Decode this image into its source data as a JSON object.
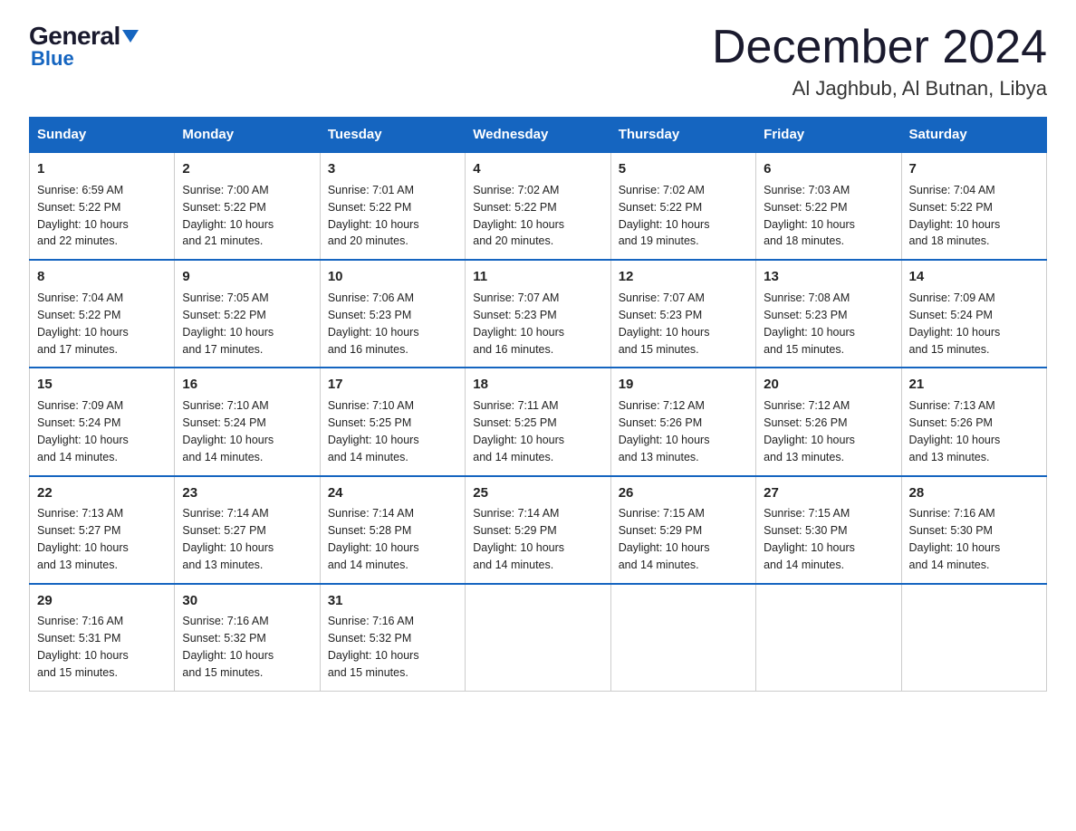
{
  "logo": {
    "general": "General",
    "triangle": "▶",
    "blue": "Blue"
  },
  "header": {
    "month": "December 2024",
    "location": "Al Jaghbub, Al Butnan, Libya"
  },
  "days_of_week": [
    "Sunday",
    "Monday",
    "Tuesday",
    "Wednesday",
    "Thursday",
    "Friday",
    "Saturday"
  ],
  "weeks": [
    [
      {
        "day": "1",
        "info": "Sunrise: 6:59 AM\nSunset: 5:22 PM\nDaylight: 10 hours\nand 22 minutes."
      },
      {
        "day": "2",
        "info": "Sunrise: 7:00 AM\nSunset: 5:22 PM\nDaylight: 10 hours\nand 21 minutes."
      },
      {
        "day": "3",
        "info": "Sunrise: 7:01 AM\nSunset: 5:22 PM\nDaylight: 10 hours\nand 20 minutes."
      },
      {
        "day": "4",
        "info": "Sunrise: 7:02 AM\nSunset: 5:22 PM\nDaylight: 10 hours\nand 20 minutes."
      },
      {
        "day": "5",
        "info": "Sunrise: 7:02 AM\nSunset: 5:22 PM\nDaylight: 10 hours\nand 19 minutes."
      },
      {
        "day": "6",
        "info": "Sunrise: 7:03 AM\nSunset: 5:22 PM\nDaylight: 10 hours\nand 18 minutes."
      },
      {
        "day": "7",
        "info": "Sunrise: 7:04 AM\nSunset: 5:22 PM\nDaylight: 10 hours\nand 18 minutes."
      }
    ],
    [
      {
        "day": "8",
        "info": "Sunrise: 7:04 AM\nSunset: 5:22 PM\nDaylight: 10 hours\nand 17 minutes."
      },
      {
        "day": "9",
        "info": "Sunrise: 7:05 AM\nSunset: 5:22 PM\nDaylight: 10 hours\nand 17 minutes."
      },
      {
        "day": "10",
        "info": "Sunrise: 7:06 AM\nSunset: 5:23 PM\nDaylight: 10 hours\nand 16 minutes."
      },
      {
        "day": "11",
        "info": "Sunrise: 7:07 AM\nSunset: 5:23 PM\nDaylight: 10 hours\nand 16 minutes."
      },
      {
        "day": "12",
        "info": "Sunrise: 7:07 AM\nSunset: 5:23 PM\nDaylight: 10 hours\nand 15 minutes."
      },
      {
        "day": "13",
        "info": "Sunrise: 7:08 AM\nSunset: 5:23 PM\nDaylight: 10 hours\nand 15 minutes."
      },
      {
        "day": "14",
        "info": "Sunrise: 7:09 AM\nSunset: 5:24 PM\nDaylight: 10 hours\nand 15 minutes."
      }
    ],
    [
      {
        "day": "15",
        "info": "Sunrise: 7:09 AM\nSunset: 5:24 PM\nDaylight: 10 hours\nand 14 minutes."
      },
      {
        "day": "16",
        "info": "Sunrise: 7:10 AM\nSunset: 5:24 PM\nDaylight: 10 hours\nand 14 minutes."
      },
      {
        "day": "17",
        "info": "Sunrise: 7:10 AM\nSunset: 5:25 PM\nDaylight: 10 hours\nand 14 minutes."
      },
      {
        "day": "18",
        "info": "Sunrise: 7:11 AM\nSunset: 5:25 PM\nDaylight: 10 hours\nand 14 minutes."
      },
      {
        "day": "19",
        "info": "Sunrise: 7:12 AM\nSunset: 5:26 PM\nDaylight: 10 hours\nand 13 minutes."
      },
      {
        "day": "20",
        "info": "Sunrise: 7:12 AM\nSunset: 5:26 PM\nDaylight: 10 hours\nand 13 minutes."
      },
      {
        "day": "21",
        "info": "Sunrise: 7:13 AM\nSunset: 5:26 PM\nDaylight: 10 hours\nand 13 minutes."
      }
    ],
    [
      {
        "day": "22",
        "info": "Sunrise: 7:13 AM\nSunset: 5:27 PM\nDaylight: 10 hours\nand 13 minutes."
      },
      {
        "day": "23",
        "info": "Sunrise: 7:14 AM\nSunset: 5:27 PM\nDaylight: 10 hours\nand 13 minutes."
      },
      {
        "day": "24",
        "info": "Sunrise: 7:14 AM\nSunset: 5:28 PM\nDaylight: 10 hours\nand 14 minutes."
      },
      {
        "day": "25",
        "info": "Sunrise: 7:14 AM\nSunset: 5:29 PM\nDaylight: 10 hours\nand 14 minutes."
      },
      {
        "day": "26",
        "info": "Sunrise: 7:15 AM\nSunset: 5:29 PM\nDaylight: 10 hours\nand 14 minutes."
      },
      {
        "day": "27",
        "info": "Sunrise: 7:15 AM\nSunset: 5:30 PM\nDaylight: 10 hours\nand 14 minutes."
      },
      {
        "day": "28",
        "info": "Sunrise: 7:16 AM\nSunset: 5:30 PM\nDaylight: 10 hours\nand 14 minutes."
      }
    ],
    [
      {
        "day": "29",
        "info": "Sunrise: 7:16 AM\nSunset: 5:31 PM\nDaylight: 10 hours\nand 15 minutes."
      },
      {
        "day": "30",
        "info": "Sunrise: 7:16 AM\nSunset: 5:32 PM\nDaylight: 10 hours\nand 15 minutes."
      },
      {
        "day": "31",
        "info": "Sunrise: 7:16 AM\nSunset: 5:32 PM\nDaylight: 10 hours\nand 15 minutes."
      },
      null,
      null,
      null,
      null
    ]
  ]
}
